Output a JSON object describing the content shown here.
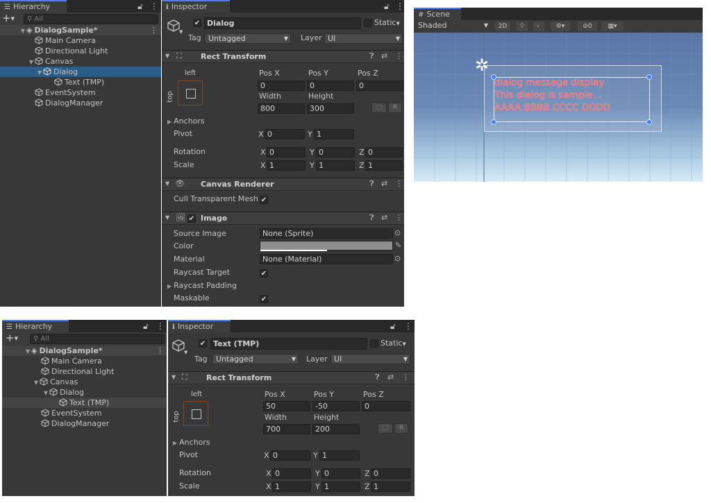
{
  "top_hierarchy": {
    "tab": "Hierarchy",
    "add_label": "+",
    "search_placeholder": "All",
    "scene": "DialogSample*",
    "items": [
      "Main Camera",
      "Directional Light",
      "Canvas",
      "Dialog",
      "Text (TMP)",
      "EventSystem",
      "DialogManager"
    ],
    "selected": "Dialog"
  },
  "top_inspector": {
    "tab": "Inspector",
    "object_name": "Dialog",
    "static_label": "Static",
    "tag_label": "Tag",
    "tag_value": "Untagged",
    "layer_label": "Layer",
    "layer_value": "UI",
    "rect": {
      "title": "Rect Transform",
      "anchor_h": "left",
      "anchor_v": "top",
      "posx_label": "Pos X",
      "posy_label": "Pos Y",
      "posz_label": "Pos Z",
      "posx": "0",
      "posy": "0",
      "posz": "0",
      "width_label": "Width",
      "height_label": "Height",
      "width": "800",
      "height": "300",
      "r_label": "R",
      "anchors_label": "Anchors",
      "pivot_label": "Pivot",
      "pivot_x": "0",
      "pivot_y": "1",
      "rotation_label": "Rotation",
      "rot_x": "0",
      "rot_y": "0",
      "rot_z": "0",
      "scale_label": "Scale",
      "scale_x": "1",
      "scale_y": "1",
      "scale_z": "1"
    },
    "canvas_renderer": {
      "title": "Canvas Renderer",
      "cull_label": "Cull Transparent Mesh"
    },
    "image": {
      "title": "Image",
      "source_label": "Source Image",
      "source_value": "None (Sprite)",
      "color_label": "Color",
      "color_value": "#8f8f8f",
      "material_label": "Material",
      "material_value": "None (Material)",
      "raycast_label": "Raycast Target",
      "padding_label": "Raycast Padding",
      "maskable_label": "Maskable"
    }
  },
  "scene": {
    "tab": "Scene",
    "shading": "Shaded",
    "mode_2d": "2D",
    "hidden_count": "0",
    "dialog_lines": [
      "dialog message display",
      "This dialog is sample...",
      "AAAA BBBB CCCC DDDD"
    ],
    "text_color": "#ff6b6b"
  },
  "bottom_hierarchy": {
    "tab": "Hierarchy",
    "add_label": "+",
    "search_placeholder": "All",
    "scene": "DialogSample*",
    "items": [
      "Main Camera",
      "Directional Light",
      "Canvas",
      "Dialog",
      "Text (TMP)",
      "EventSystem",
      "DialogManager"
    ],
    "selected": "Text (TMP)"
  },
  "bottom_inspector": {
    "tab": "Inspector",
    "object_name": "Text (TMP)",
    "static_label": "Static",
    "tag_label": "Tag",
    "tag_value": "Untagged",
    "layer_label": "Layer",
    "layer_value": "UI",
    "rect": {
      "title": "Rect Transform",
      "anchor_h": "left",
      "anchor_v": "top",
      "posx_label": "Pos X",
      "posy_label": "Pos Y",
      "posz_label": "Pos Z",
      "posx": "50",
      "posy": "-50",
      "posz": "0",
      "width_label": "Width",
      "height_label": "Height",
      "width": "700",
      "height": "200",
      "r_label": "R",
      "anchors_label": "Anchors",
      "pivot_label": "Pivot",
      "pivot_x": "0",
      "pivot_y": "1",
      "rotation_label": "Rotation",
      "rot_x": "0",
      "rot_y": "0",
      "rot_z": "0",
      "scale_label": "Scale",
      "scale_x": "1",
      "scale_y": "1",
      "scale_z": "1"
    }
  },
  "colors": {
    "panel": "#383838",
    "selection": "#2c5d87",
    "accent": "#4c7eff"
  }
}
